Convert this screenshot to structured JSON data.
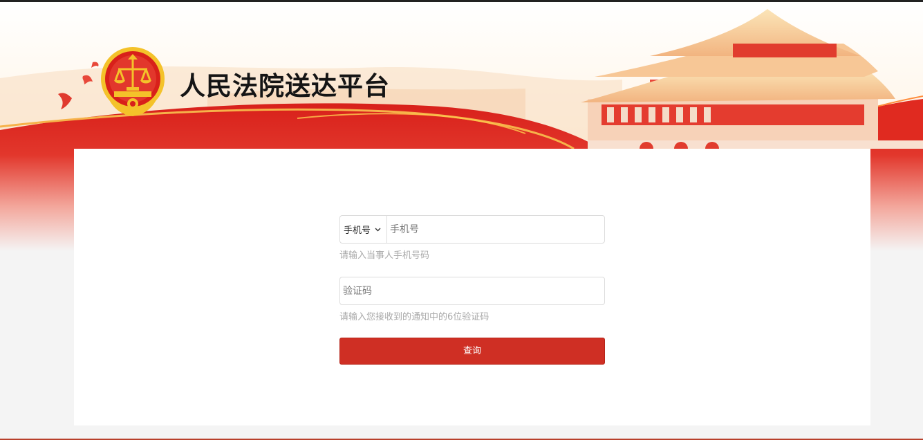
{
  "header": {
    "site_title": "人民法院送达平台"
  },
  "form": {
    "type_select": {
      "selected": "手机号"
    },
    "phone_input": {
      "placeholder": "手机号",
      "value": ""
    },
    "phone_hint": "请输入当事人手机号码",
    "code_input": {
      "placeholder": "验证码",
      "value": ""
    },
    "code_hint": "请输入您接收到的通知中的6位验证码",
    "submit_label": "查询"
  },
  "colors": {
    "brand_red": "#cf2f24",
    "banner_red": "#d8201a",
    "emblem_gold": "#f4c22a"
  },
  "icons": {
    "emblem": "court-emblem-icon",
    "select": "chevron-down-icon",
    "doves": "doves-icon"
  }
}
